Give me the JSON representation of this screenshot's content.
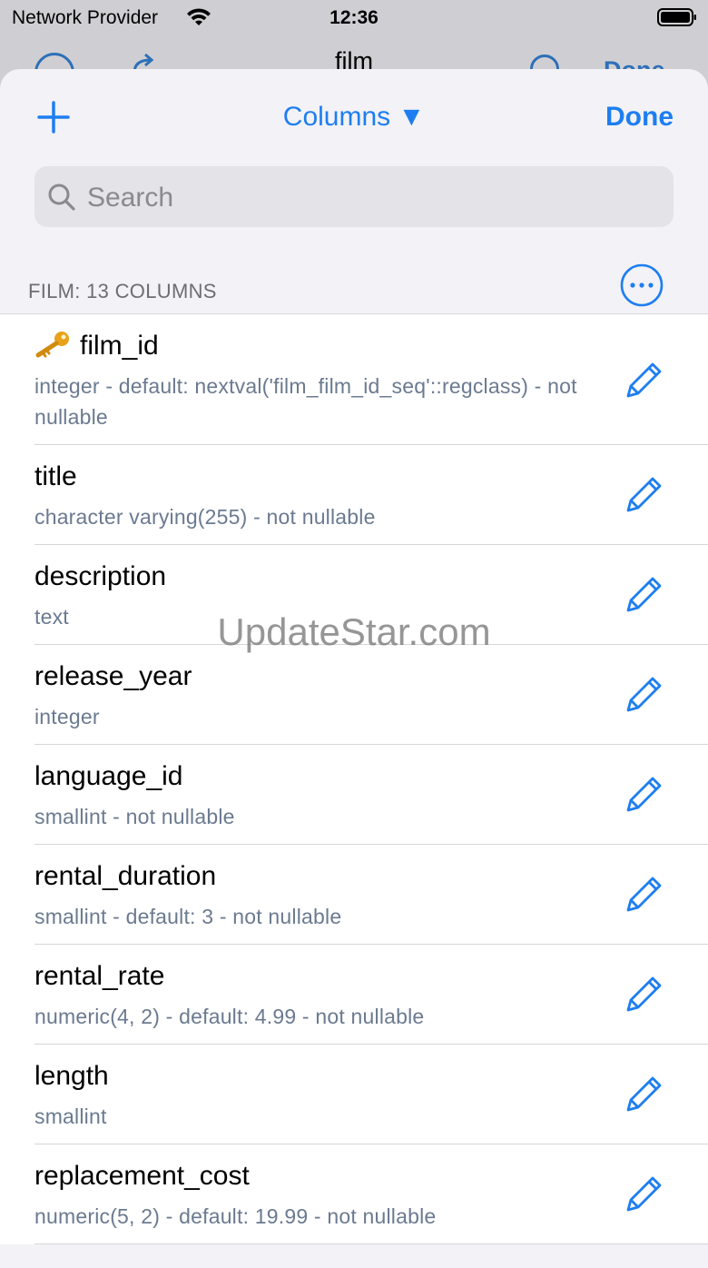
{
  "status_bar": {
    "carrier": "Network Provider",
    "time": "12:36"
  },
  "parent_nav": {
    "title": "film",
    "done_label": "Done"
  },
  "sheet": {
    "add_icon": "plus-icon",
    "columns_label": "Columns ▼",
    "done_label": "Done",
    "search": {
      "placeholder": "Search",
      "value": ""
    },
    "section_header": "FILM: 13 COLUMNS",
    "more_icon": "ellipsis-circle-icon"
  },
  "columns": [
    {
      "name": "film_id",
      "detail": "integer - default: nextval('film_film_id_seq'::regclass) - not nullable",
      "primary_key": true
    },
    {
      "name": "title",
      "detail": "character varying(255) - not nullable"
    },
    {
      "name": "description",
      "detail": "text"
    },
    {
      "name": "release_year",
      "detail": "integer"
    },
    {
      "name": "language_id",
      "detail": "smallint - not nullable"
    },
    {
      "name": "rental_duration",
      "detail": "smallint - default: 3 - not nullable"
    },
    {
      "name": "rental_rate",
      "detail": "numeric(4, 2) - default: 4.99 - not nullable"
    },
    {
      "name": "length",
      "detail": "smallint"
    },
    {
      "name": "replacement_cost",
      "detail": "numeric(5, 2) - default: 19.99 - not nullable"
    }
  ],
  "watermark": "UpdateStar.com",
  "colors": {
    "accent": "#1e7ef0",
    "sheet_bg": "#f2f2f7",
    "subtitle": "#6b7a90",
    "key": "#e8a21a"
  }
}
